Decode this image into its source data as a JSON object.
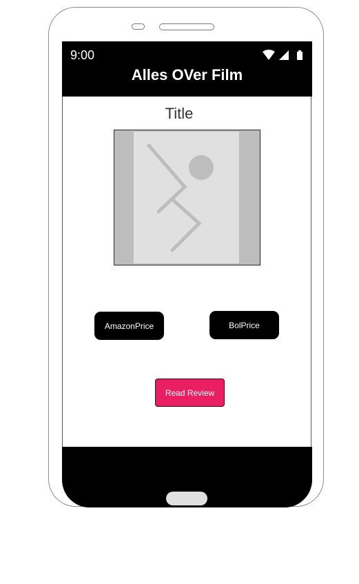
{
  "status_bar": {
    "time": "9:00"
  },
  "app_bar": {
    "title": "Alles OVer Film"
  },
  "main": {
    "title": "Title",
    "amazon_button": "AmazonPrice",
    "bol_button": "BolPrice",
    "review_button": "Read Review"
  },
  "colors": {
    "accent": "#e91e63",
    "app_bar": "#000000",
    "placeholder": "#bdbdbd"
  }
}
